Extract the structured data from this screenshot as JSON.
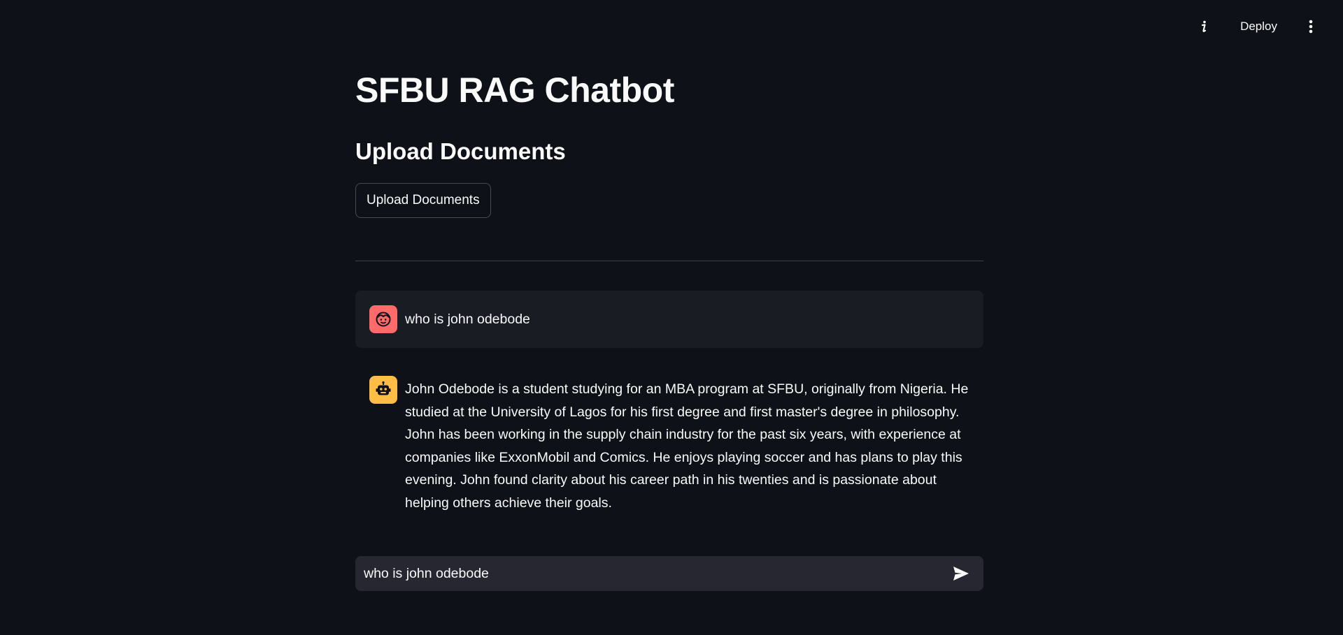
{
  "toolbar": {
    "info_icon": "info-icon",
    "deploy_label": "Deploy",
    "menu_icon": "more-vertical-icon"
  },
  "main": {
    "title": "SFBU RAG Chatbot",
    "subtitle": "Upload Documents",
    "upload_button_label": "Upload Documents"
  },
  "chat": {
    "messages": [
      {
        "role": "user",
        "avatar_icon": "user-face-icon",
        "avatar_color": "#ff6b6b",
        "text": "who is john odebode"
      },
      {
        "role": "assistant",
        "avatar_icon": "robot-icon",
        "avatar_color": "#ffbd45",
        "text": "John Odebode is a student studying for an MBA program at SFBU, originally from Nigeria. He studied at the University of Lagos for his first degree and first master's degree in philosophy. John has been working in the supply chain industry for the past six years, with experience at companies like ExxonMobil and Comics. He enjoys playing soccer and has plans to play this evening. John found clarity about his career path in his twenties and is passionate about helping others achieve their goals."
      }
    ],
    "input_value": "who is john odebode",
    "send_icon": "send-icon"
  },
  "colors": {
    "background": "#0e1117",
    "text": "#fafafa",
    "user_bubble": "#1a1c24",
    "input_bg": "#262730"
  }
}
